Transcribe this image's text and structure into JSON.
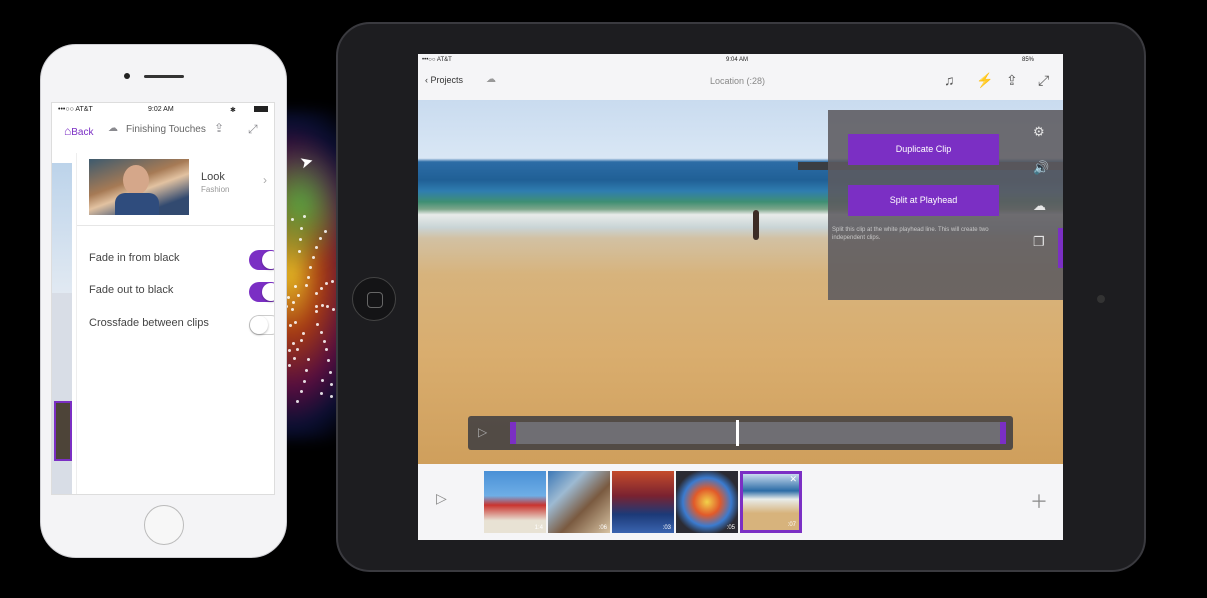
{
  "colors": {
    "accent": "#7b2fc4",
    "background": "#000000"
  },
  "iphone": {
    "status": {
      "carrier": "•••○○ AT&T",
      "wifi_icon": "wifi-icon",
      "time": "9:02 AM"
    },
    "nav": {
      "back_label": "Back",
      "title": "Finishing Touches"
    },
    "look": {
      "title": "Look",
      "subtitle": "Fashion"
    },
    "options": [
      {
        "label": "Fade in from black",
        "on": true
      },
      {
        "label": "Fade out to black",
        "on": true
      },
      {
        "label": "Crossfade between clips",
        "on": false
      }
    ]
  },
  "ipad": {
    "status": {
      "carrier": "•••○○ AT&T",
      "time": "9:04 AM",
      "battery": "85%"
    },
    "nav": {
      "back_label": "Projects",
      "title": "Location (:28)"
    },
    "popover": {
      "duplicate_label": "Duplicate Clip",
      "split_label": "Split at Playhead",
      "note": "Split this clip at the white playhead line. This will create two independent clips."
    },
    "timeline": {
      "clips": [
        {
          "duration": "1:4",
          "selected": false
        },
        {
          "duration": ":06",
          "selected": false
        },
        {
          "duration": ":03",
          "selected": false
        },
        {
          "duration": ":05",
          "selected": false
        },
        {
          "duration": ":07",
          "selected": true
        }
      ]
    }
  }
}
